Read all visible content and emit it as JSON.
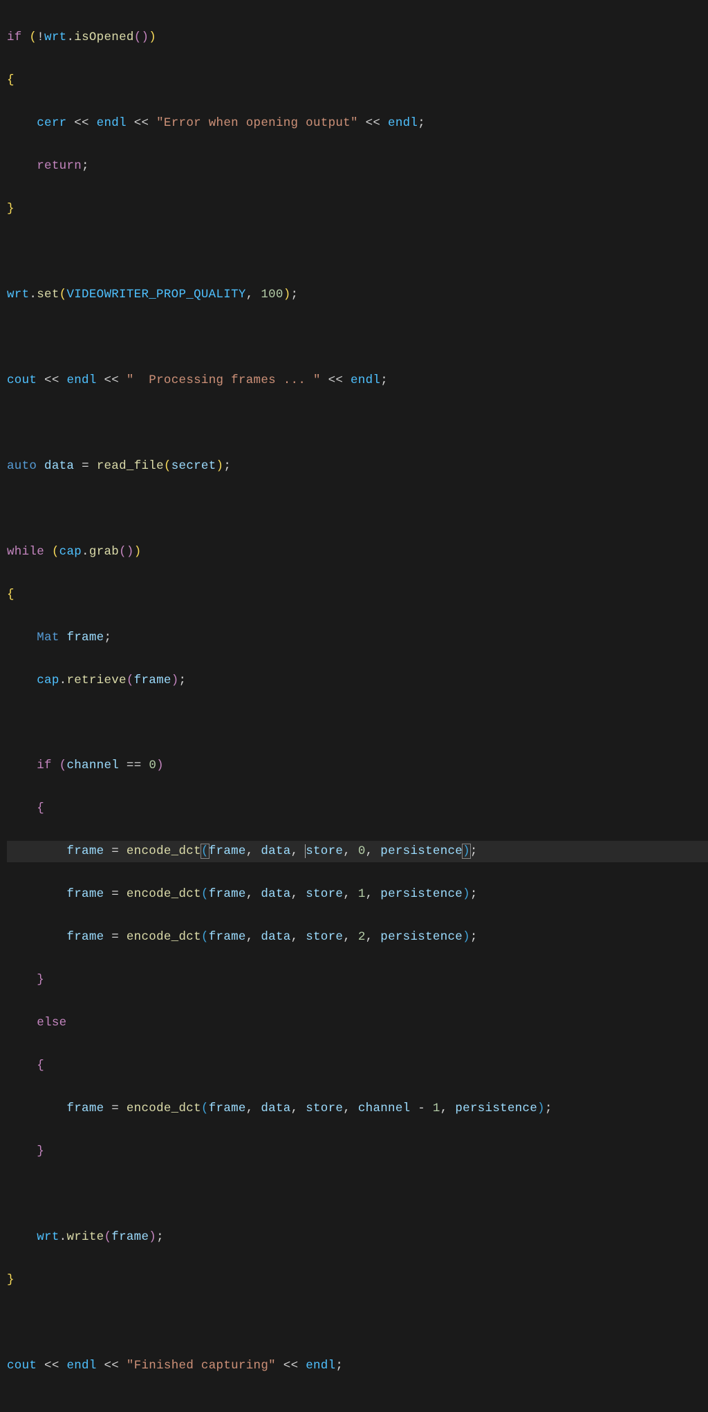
{
  "code": {
    "l1": {
      "if": "if",
      "bang": "!",
      "wrt": "wrt",
      "dot": ".",
      "isOpened": "isOpened",
      "lp": "(",
      "rp": ")",
      "op": "(",
      "cp": ")"
    },
    "l2": "{",
    "l3": {
      "cerr": "cerr",
      "ls": "<<",
      "endl": "endl",
      "msg": "\"Error when opening output\""
    },
    "l4": {
      "ret": "return",
      "semi": ";"
    },
    "l5": "}",
    "l7": {
      "wrt": "wrt",
      "set": "set",
      "const": "VIDEOWRITER_PROP_QUALITY",
      "num": "100"
    },
    "l9": {
      "cout": "cout",
      "ls": "<<",
      "endl": "endl",
      "msg": "\"  Processing frames ... \""
    },
    "l11": {
      "auto": "auto",
      "data": "data",
      "eq": "=",
      "read_file": "read_file",
      "secret": "secret"
    },
    "l13": {
      "while": "while",
      "cap": "cap",
      "grab": "grab"
    },
    "l14": "{",
    "l15": {
      "Mat": "Mat",
      "frame": "frame"
    },
    "l16": {
      "cap": "cap",
      "retrieve": "retrieve",
      "frame": "frame"
    },
    "l18": {
      "if": "if",
      "channel": "channel",
      "eq": "==",
      "zero": "0"
    },
    "l19": "{",
    "l20": {
      "frame": "frame",
      "eq": "=",
      "encode_dct": "encode_dct",
      "data": "data",
      "store": "store",
      "num": "0",
      "persistence": "persistence"
    },
    "l21": {
      "frame": "frame",
      "eq": "=",
      "encode_dct": "encode_dct",
      "data": "data",
      "store": "store",
      "num": "1",
      "persistence": "persistence"
    },
    "l22": {
      "frame": "frame",
      "eq": "=",
      "encode_dct": "encode_dct",
      "data": "data",
      "store": "store",
      "num": "2",
      "persistence": "persistence"
    },
    "l23": "}",
    "l24": {
      "else": "else"
    },
    "l25": "{",
    "l26": {
      "frame": "frame",
      "eq": "=",
      "encode_dct": "encode_dct",
      "data": "data",
      "store": "store",
      "channel": "channel",
      "minus": "-",
      "one": "1",
      "persistence": "persistence"
    },
    "l27": "}",
    "l29": {
      "wrt": "wrt",
      "write": "write",
      "frame": "frame"
    },
    "l30": "}",
    "l32": {
      "cout": "cout",
      "ls": "<<",
      "endl": "endl",
      "msg": "\"Finished capturing\""
    }
  }
}
